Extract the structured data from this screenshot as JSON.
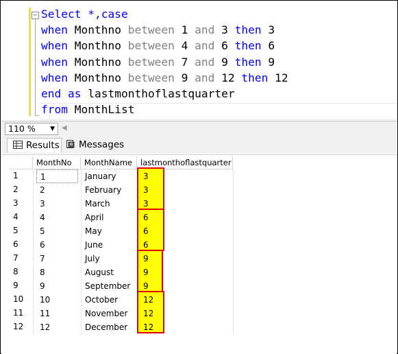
{
  "editor": {
    "lines": [
      [
        {
          "t": "Select *,case",
          "c": "kw"
        }
      ],
      [
        {
          "t": "when ",
          "c": "kw"
        },
        {
          "t": "Monthno ",
          "c": "id"
        },
        {
          "t": "between ",
          "c": "op"
        },
        {
          "t": "1 ",
          "c": "id"
        },
        {
          "t": "and ",
          "c": "op"
        },
        {
          "t": "3 ",
          "c": "id"
        },
        {
          "t": "then ",
          "c": "kw"
        },
        {
          "t": "3",
          "c": "id"
        }
      ],
      [
        {
          "t": "when ",
          "c": "kw"
        },
        {
          "t": "Monthno ",
          "c": "id"
        },
        {
          "t": "between ",
          "c": "op"
        },
        {
          "t": "4 ",
          "c": "id"
        },
        {
          "t": "and ",
          "c": "op"
        },
        {
          "t": "6 ",
          "c": "id"
        },
        {
          "t": "then ",
          "c": "kw"
        },
        {
          "t": "6",
          "c": "id"
        }
      ],
      [
        {
          "t": "when ",
          "c": "kw"
        },
        {
          "t": "Monthno ",
          "c": "id"
        },
        {
          "t": "between ",
          "c": "op"
        },
        {
          "t": "7 ",
          "c": "id"
        },
        {
          "t": "and ",
          "c": "op"
        },
        {
          "t": "9 ",
          "c": "id"
        },
        {
          "t": "then ",
          "c": "kw"
        },
        {
          "t": "9",
          "c": "id"
        }
      ],
      [
        {
          "t": "when ",
          "c": "kw"
        },
        {
          "t": "Monthno ",
          "c": "id"
        },
        {
          "t": "between ",
          "c": "op"
        },
        {
          "t": "9 ",
          "c": "id"
        },
        {
          "t": "and ",
          "c": "op"
        },
        {
          "t": "12 ",
          "c": "id"
        },
        {
          "t": "then ",
          "c": "kw"
        },
        {
          "t": "12",
          "c": "id"
        }
      ],
      [
        {
          "t": "end as ",
          "c": "kw"
        },
        {
          "t": "lastmonthoflastquarter",
          "c": "id"
        }
      ],
      [
        {
          "t": "from ",
          "c": "kw"
        },
        {
          "t": "MonthList",
          "c": "id"
        }
      ]
    ],
    "fold_symbol": "−"
  },
  "zoom": {
    "value": "110 %",
    "arrow": "▼"
  },
  "scroll_left_symbol": "◀",
  "tabs": {
    "results": "Results",
    "messages": "Messages"
  },
  "grid": {
    "columns": [
      "MonthNo",
      "MonthName",
      "lastmonthoflastquarter"
    ],
    "rows": [
      [
        "1",
        "1",
        "January",
        "3"
      ],
      [
        "2",
        "2",
        "February",
        "3"
      ],
      [
        "3",
        "3",
        "March",
        "3"
      ],
      [
        "4",
        "4",
        "April",
        "6"
      ],
      [
        "5",
        "5",
        "May",
        "6"
      ],
      [
        "6",
        "6",
        "June",
        "6"
      ],
      [
        "7",
        "7",
        "July",
        "9"
      ],
      [
        "8",
        "8",
        "August",
        "9"
      ],
      [
        "9",
        "9",
        "September",
        "9"
      ],
      [
        "10",
        "10",
        "October",
        "12"
      ],
      [
        "11",
        "11",
        "November",
        "12"
      ],
      [
        "12",
        "12",
        "December",
        "12"
      ]
    ]
  },
  "colors": {
    "keyword": "#0000ff",
    "operator": "#808080",
    "highlight": "#ffff00",
    "highlight_border": "#e00000"
  }
}
